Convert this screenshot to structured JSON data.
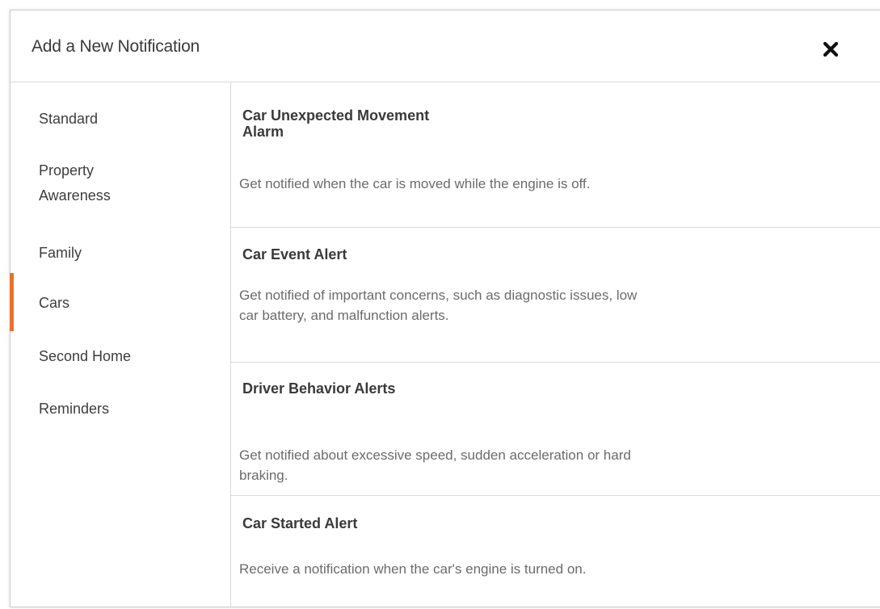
{
  "dialog": {
    "title": "Add a New Notification",
    "close_icon": "close-icon",
    "accent_color": "#e8722b"
  },
  "sidebar": {
    "active_index": 3,
    "items": [
      {
        "label": "Standard"
      },
      {
        "label": "Property Awareness"
      },
      {
        "label": "Family"
      },
      {
        "label": "Cars"
      },
      {
        "label": "Second Home"
      },
      {
        "label": "Reminders"
      }
    ]
  },
  "notifications": [
    {
      "title": "Car Unexpected Movement Alarm",
      "description": "Get notified when the car is moved while the engine is off."
    },
    {
      "title": "Car Event Alert",
      "description": "Get notified of important concerns, such as diagnostic issues, low car battery, and malfunction alerts."
    },
    {
      "title": "Driver Behavior Alerts",
      "description": "Get notified about excessive speed, sudden acceleration or hard braking."
    },
    {
      "title": "Car Started Alert",
      "description": "Receive a notification when the car's engine is turned on."
    }
  ]
}
